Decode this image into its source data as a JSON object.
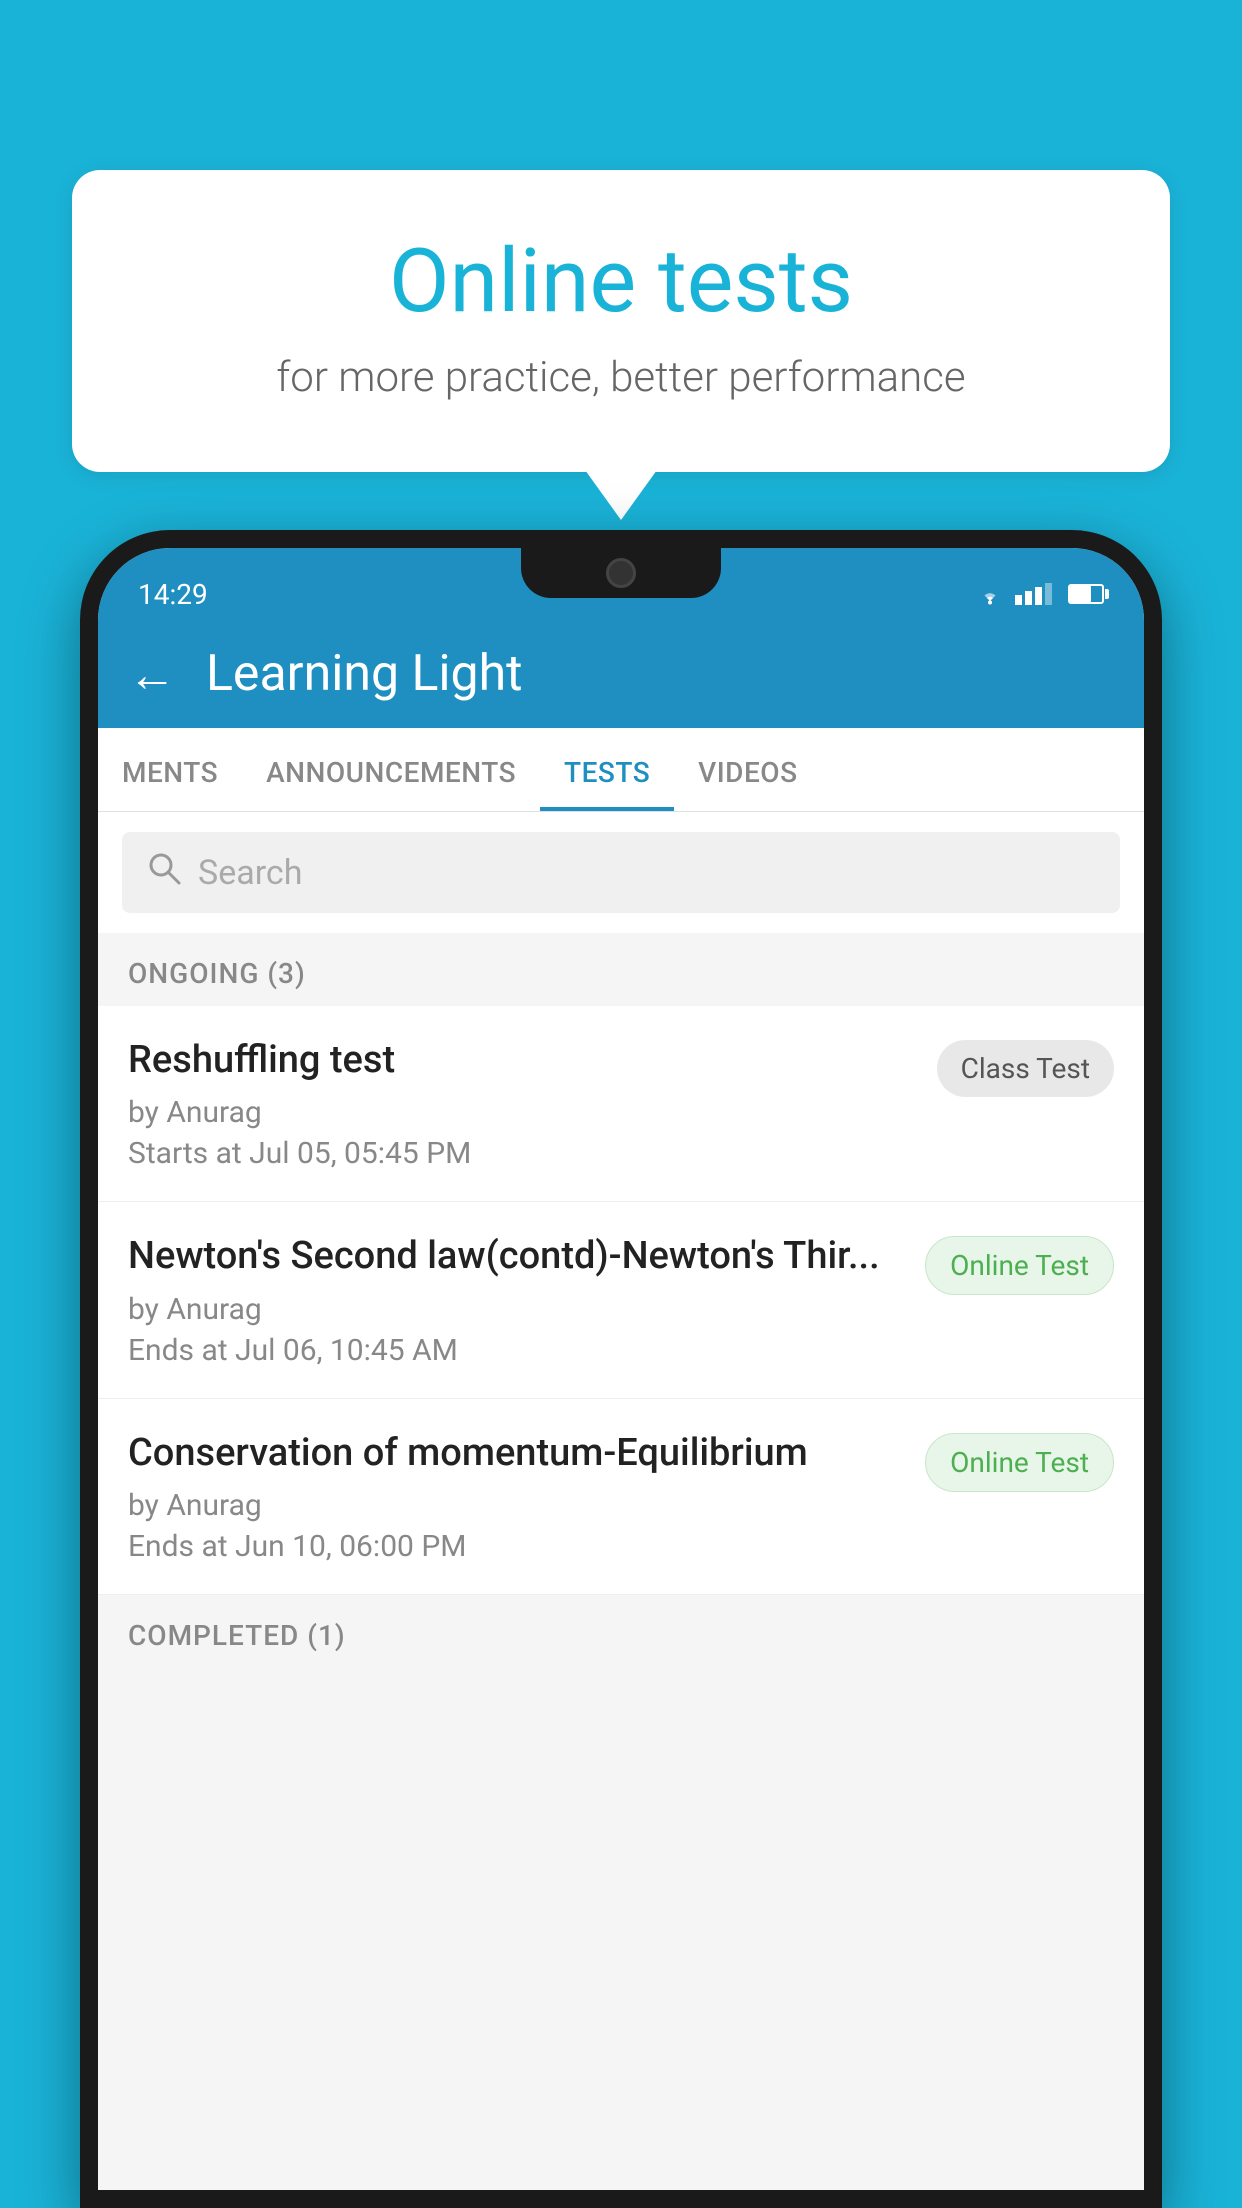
{
  "background_color": "#1ab3d8",
  "bubble": {
    "title": "Online tests",
    "subtitle": "for more practice, better performance"
  },
  "status_bar": {
    "time": "14:29"
  },
  "app_bar": {
    "back_label": "←",
    "title": "Learning Light"
  },
  "tabs": [
    {
      "label": "MENTS",
      "active": false
    },
    {
      "label": "ANNOUNCEMENTS",
      "active": false
    },
    {
      "label": "TESTS",
      "active": true
    },
    {
      "label": "VIDEOS",
      "active": false
    }
  ],
  "search": {
    "placeholder": "Search"
  },
  "ongoing_section": {
    "header": "ONGOING (3)"
  },
  "tests": [
    {
      "name": "Reshuffling test",
      "by": "by Anurag",
      "date": "Starts at  Jul 05, 05:45 PM",
      "badge": "Class Test",
      "badge_type": "class"
    },
    {
      "name": "Newton's Second law(contd)-Newton's Thir...",
      "by": "by Anurag",
      "date": "Ends at  Jul 06, 10:45 AM",
      "badge": "Online Test",
      "badge_type": "online"
    },
    {
      "name": "Conservation of momentum-Equilibrium",
      "by": "by Anurag",
      "date": "Ends at  Jun 10, 06:00 PM",
      "badge": "Online Test",
      "badge_type": "online"
    }
  ],
  "completed_section": {
    "header": "COMPLETED (1)"
  }
}
